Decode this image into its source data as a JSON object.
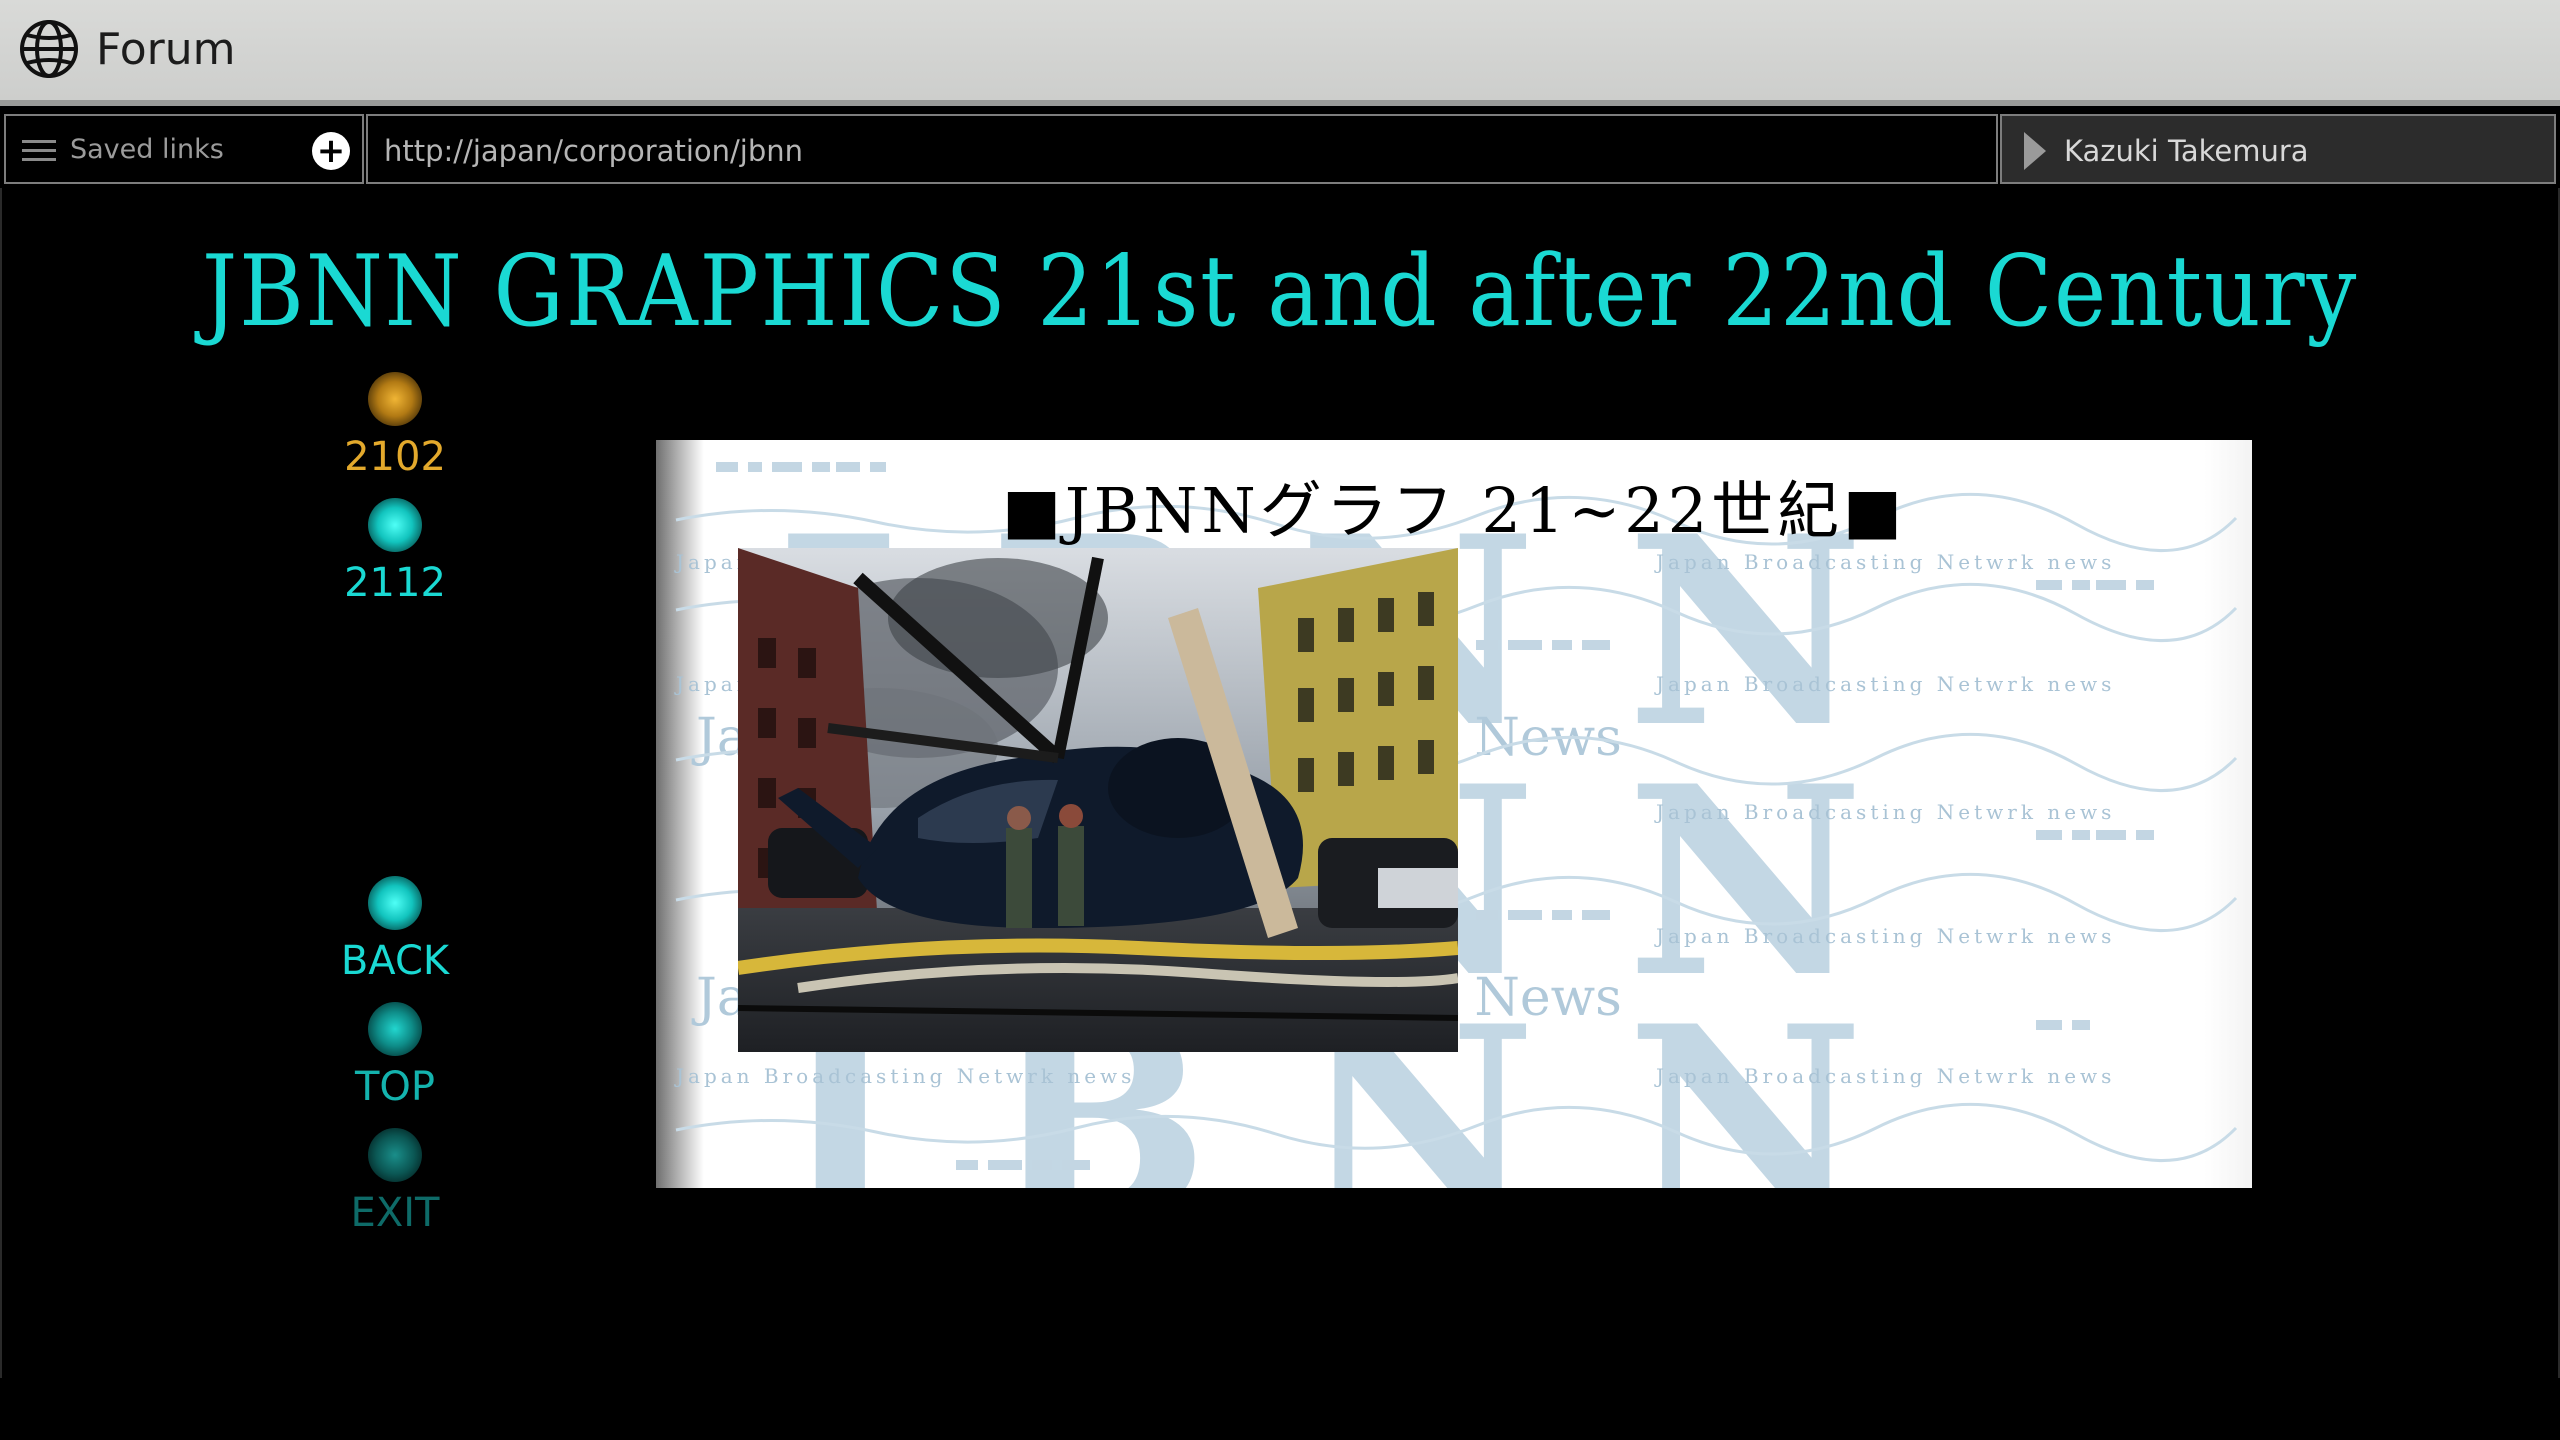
{
  "app": {
    "title": "Forum"
  },
  "toolbar": {
    "saved_links_label": "Saved links",
    "add_icon": "plus-circle-icon",
    "url": "http://japan/corporation/jbnn",
    "user_name": "Kazuki Takemura"
  },
  "page": {
    "title": "JBNN GRAPHICS 21st and after 22nd Century",
    "nav": [
      {
        "label": "2102",
        "color": "#e3a92c"
      },
      {
        "label": "2112",
        "color": "#1ad9d3"
      },
      {
        "label": "BACK",
        "color": "#1ad9d3"
      },
      {
        "label": "TOP",
        "color": "#14b3ae"
      },
      {
        "label": "EXIT",
        "color": "#0e6b68"
      }
    ],
    "graphic": {
      "caption": "■JBNNグラフ 21~22世紀■",
      "watermark_big": "JBNN",
      "watermark_mid": "Japan Broadcasting Network News",
      "watermark_small": "Japan Broadcasting Netwrk news"
    }
  },
  "colors": {
    "accent": "#1ad9d3",
    "gold": "#e3a92c",
    "titlebar": "#d4d5d3"
  }
}
